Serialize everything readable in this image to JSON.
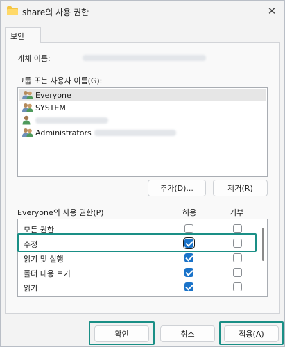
{
  "window": {
    "title": "share의 사용 권한",
    "close_glyph": "✕"
  },
  "tab": {
    "label": "보안"
  },
  "object": {
    "label": "개체 이름:"
  },
  "groups": {
    "label": "그룹 또는 사용자 이름(G):",
    "items": [
      {
        "name": "Everyone",
        "icon": "group-users-icon",
        "selected": true
      },
      {
        "name": "SYSTEM",
        "icon": "group-users-icon",
        "selected": false
      },
      {
        "name": "",
        "icon": "user-icon",
        "selected": false
      },
      {
        "name": "Administrators",
        "icon": "group-users-icon",
        "selected": false
      }
    ],
    "add_label": "추가(D)...",
    "remove_label": "제거(R)"
  },
  "permissions": {
    "label": "Everyone의 사용 권한(P)",
    "allow_header": "허용",
    "deny_header": "거부",
    "rows": [
      {
        "name": "모든 권한",
        "allow": false,
        "deny": false
      },
      {
        "name": "수정",
        "allow": true,
        "deny": false
      },
      {
        "name": "읽기 및 실행",
        "allow": true,
        "deny": false
      },
      {
        "name": "폴더 내용 보기",
        "allow": true,
        "deny": false
      },
      {
        "name": "읽기",
        "allow": true,
        "deny": false
      }
    ]
  },
  "footer": {
    "ok_label": "확인",
    "cancel_label": "취소",
    "apply_label": "적용(A)"
  },
  "colors": {
    "accent": "#1a73c9",
    "highlight": "#1a8f86"
  }
}
